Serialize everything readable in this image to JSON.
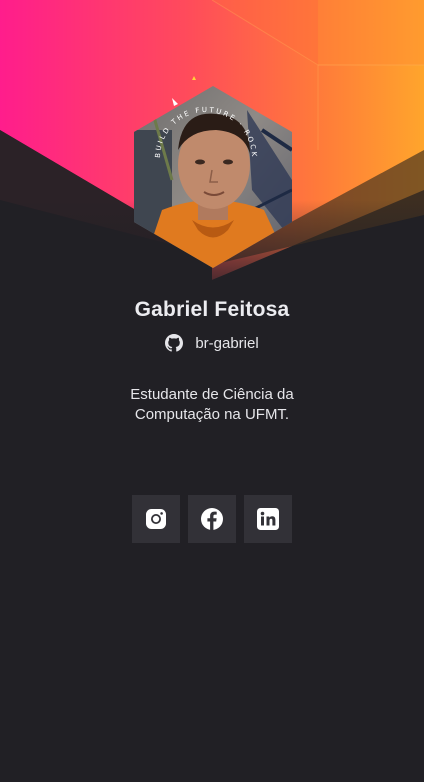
{
  "profile": {
    "name": "Gabriel Feitosa",
    "github_handle": "br-gabriel",
    "bio": "Estudante de Ciência da Computação na UFMT.",
    "badge_text": "BUILD THE FUTURE · ROCKETSEAT"
  },
  "theme": {
    "background": "#212025",
    "gradient_start": "#ff1d8c",
    "gradient_mid": "#ff6a3d",
    "gradient_end": "#ffa52c",
    "button_bg": "#323137"
  },
  "socials": [
    {
      "icon": "instagram-icon",
      "label": "Instagram"
    },
    {
      "icon": "facebook-icon",
      "label": "Facebook"
    },
    {
      "icon": "linkedin-icon",
      "label": "LinkedIn"
    }
  ]
}
